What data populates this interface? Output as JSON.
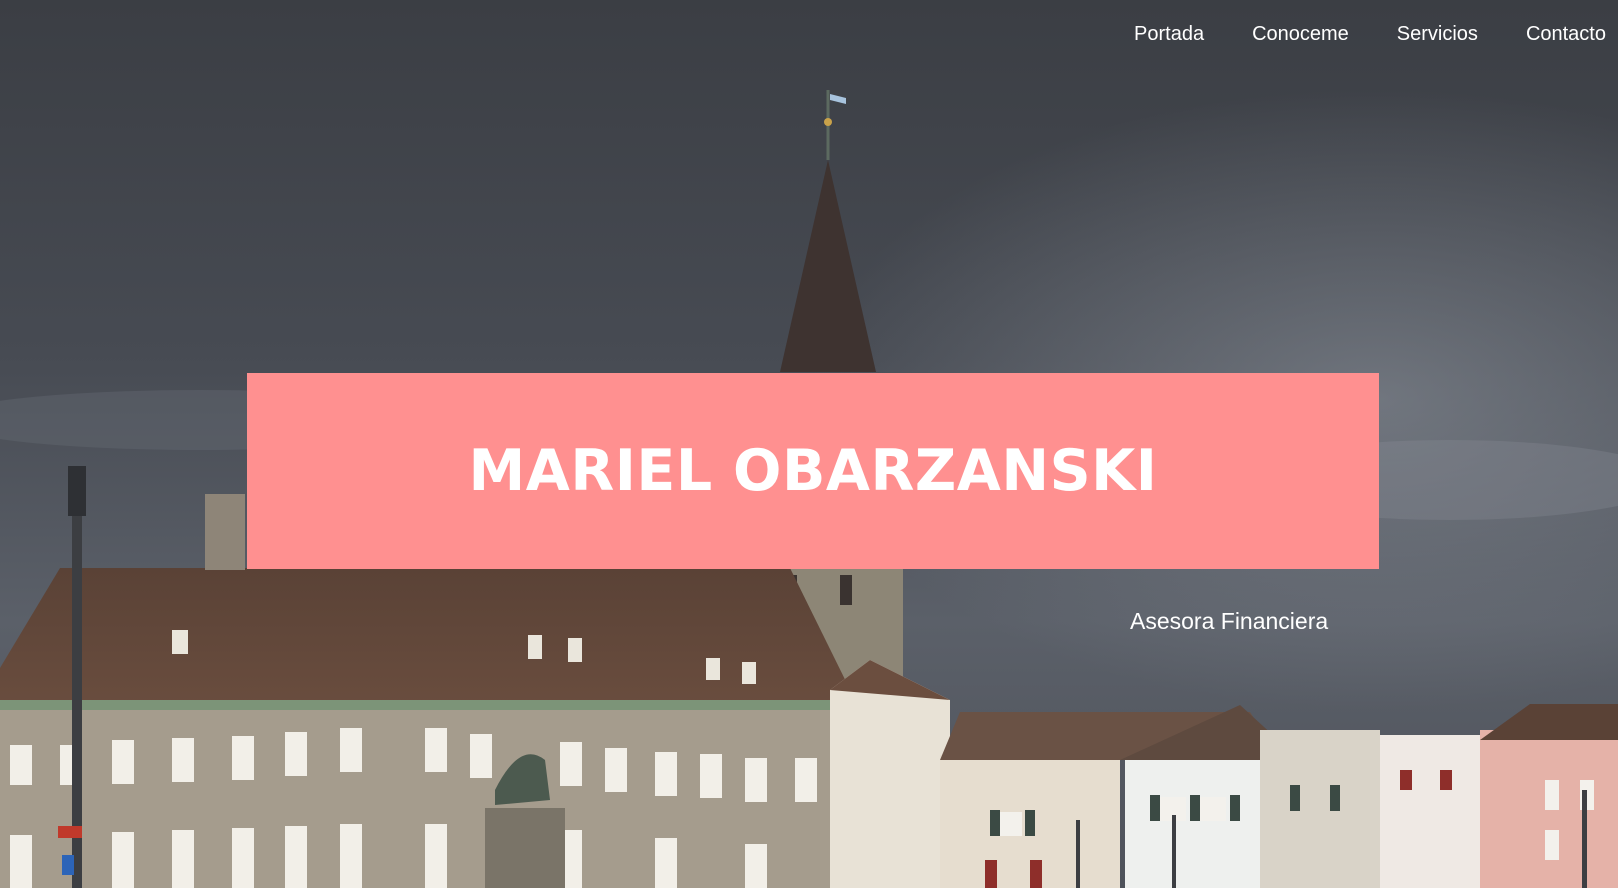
{
  "nav": {
    "items": [
      {
        "label": "Portada"
      },
      {
        "label": "Conoceme"
      },
      {
        "label": "Servicios"
      },
      {
        "label": "Contacto"
      }
    ]
  },
  "hero": {
    "title": "MARIEL OBARZANSKI",
    "subtitle": "Asesora Financiera",
    "accent_color": "#ff9090"
  }
}
